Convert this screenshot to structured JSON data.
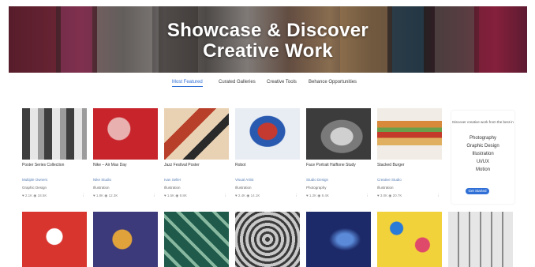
{
  "hero": {
    "title_line1": "Showcase & Discover",
    "title_line2": "Creative Work"
  },
  "nav": {
    "items": [
      {
        "label": "Most Featured",
        "active": true
      },
      {
        "label": "Curated Galleries",
        "active": false
      },
      {
        "label": "Creative Tools",
        "active": false
      },
      {
        "label": "Behance Opportunities",
        "active": false
      }
    ]
  },
  "cards_row1": [
    {
      "title": "Poster Series Collection",
      "author": "Multiple Owners",
      "category": "Graphic Design",
      "stats": "♥ 2.1K   ◉ 18.5K",
      "colors": [
        "#4a4a4a",
        "#d9d9d9"
      ]
    },
    {
      "title": "Nike – Air Max Day",
      "author": "Nike Studio",
      "category": "Illustration",
      "stats": "♥ 1.8K   ◉ 12.3K",
      "colors": [
        "#c8242c",
        "#e8b0ae"
      ]
    },
    {
      "title": "Jazz Festival Poster",
      "author": "Ivan Seller",
      "category": "Illustration",
      "stats": "♥ 1.5K   ◉ 9.8K",
      "colors": [
        "#e9d2b4",
        "#b8402a"
      ]
    },
    {
      "title": "Robot",
      "author": "Visual Artist",
      "category": "Illustration",
      "stats": "♥ 2.4K   ◉ 14.1K",
      "colors": [
        "#e8edf4",
        "#c43a30"
      ]
    },
    {
      "title": "Face Portrait Halftone Study",
      "author": "Studio Design",
      "category": "Photography",
      "stats": "♥ 1.2K   ◉ 8.4K",
      "colors": [
        "#9a9a9a",
        "#4c4c4c"
      ]
    },
    {
      "title": "Stacked Burger",
      "author": "Creative Studio",
      "category": "Illustration",
      "stats": "♥ 3.0K   ◉ 20.7K",
      "colors": [
        "#f1ede6",
        "#d88a3a"
      ]
    }
  ],
  "promo": {
    "intro": "Discover creative work from the best in",
    "lines": [
      "Photography",
      "Graphic Design",
      "Illustration",
      "UI/UX",
      "Motion"
    ],
    "button": "Get Started"
  },
  "cards_row2": [
    {
      "colors": [
        "#d8352f",
        "#ffffff"
      ]
    },
    {
      "colors": [
        "#3c3a7a",
        "#e0a23a"
      ]
    },
    {
      "colors": [
        "#1f5a4a",
        "#88b9a0"
      ]
    },
    {
      "colors": [
        "#c8c8c8",
        "#3a3a3a"
      ]
    },
    {
      "colors": [
        "#1c2a6a",
        "#5a8ad8"
      ]
    },
    {
      "colors": [
        "#f2d23a",
        "#2a7ad8"
      ]
    },
    {
      "colors": [
        "#e6e6e6",
        "#8a8a8a"
      ]
    }
  ]
}
